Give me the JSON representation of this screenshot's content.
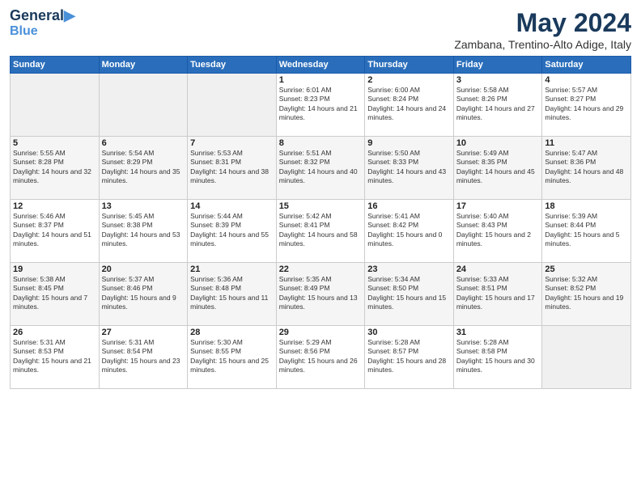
{
  "header": {
    "logo_line1": "General",
    "logo_line2": "Blue",
    "month": "May 2024",
    "location": "Zambana, Trentino-Alto Adige, Italy"
  },
  "weekdays": [
    "Sunday",
    "Monday",
    "Tuesday",
    "Wednesday",
    "Thursday",
    "Friday",
    "Saturday"
  ],
  "rows": [
    [
      {
        "day": "",
        "empty": true
      },
      {
        "day": "",
        "empty": true
      },
      {
        "day": "",
        "empty": true
      },
      {
        "day": "1",
        "sunrise": "6:01 AM",
        "sunset": "8:23 PM",
        "daylight": "14 hours and 21 minutes."
      },
      {
        "day": "2",
        "sunrise": "6:00 AM",
        "sunset": "8:24 PM",
        "daylight": "14 hours and 24 minutes."
      },
      {
        "day": "3",
        "sunrise": "5:58 AM",
        "sunset": "8:26 PM",
        "daylight": "14 hours and 27 minutes."
      },
      {
        "day": "4",
        "sunrise": "5:57 AM",
        "sunset": "8:27 PM",
        "daylight": "14 hours and 29 minutes."
      }
    ],
    [
      {
        "day": "5",
        "sunrise": "5:55 AM",
        "sunset": "8:28 PM",
        "daylight": "14 hours and 32 minutes."
      },
      {
        "day": "6",
        "sunrise": "5:54 AM",
        "sunset": "8:29 PM",
        "daylight": "14 hours and 35 minutes."
      },
      {
        "day": "7",
        "sunrise": "5:53 AM",
        "sunset": "8:31 PM",
        "daylight": "14 hours and 38 minutes."
      },
      {
        "day": "8",
        "sunrise": "5:51 AM",
        "sunset": "8:32 PM",
        "daylight": "14 hours and 40 minutes."
      },
      {
        "day": "9",
        "sunrise": "5:50 AM",
        "sunset": "8:33 PM",
        "daylight": "14 hours and 43 minutes."
      },
      {
        "day": "10",
        "sunrise": "5:49 AM",
        "sunset": "8:35 PM",
        "daylight": "14 hours and 45 minutes."
      },
      {
        "day": "11",
        "sunrise": "5:47 AM",
        "sunset": "8:36 PM",
        "daylight": "14 hours and 48 minutes."
      }
    ],
    [
      {
        "day": "12",
        "sunrise": "5:46 AM",
        "sunset": "8:37 PM",
        "daylight": "14 hours and 51 minutes."
      },
      {
        "day": "13",
        "sunrise": "5:45 AM",
        "sunset": "8:38 PM",
        "daylight": "14 hours and 53 minutes."
      },
      {
        "day": "14",
        "sunrise": "5:44 AM",
        "sunset": "8:39 PM",
        "daylight": "14 hours and 55 minutes."
      },
      {
        "day": "15",
        "sunrise": "5:42 AM",
        "sunset": "8:41 PM",
        "daylight": "14 hours and 58 minutes."
      },
      {
        "day": "16",
        "sunrise": "5:41 AM",
        "sunset": "8:42 PM",
        "daylight": "15 hours and 0 minutes."
      },
      {
        "day": "17",
        "sunrise": "5:40 AM",
        "sunset": "8:43 PM",
        "daylight": "15 hours and 2 minutes."
      },
      {
        "day": "18",
        "sunrise": "5:39 AM",
        "sunset": "8:44 PM",
        "daylight": "15 hours and 5 minutes."
      }
    ],
    [
      {
        "day": "19",
        "sunrise": "5:38 AM",
        "sunset": "8:45 PM",
        "daylight": "15 hours and 7 minutes."
      },
      {
        "day": "20",
        "sunrise": "5:37 AM",
        "sunset": "8:46 PM",
        "daylight": "15 hours and 9 minutes."
      },
      {
        "day": "21",
        "sunrise": "5:36 AM",
        "sunset": "8:48 PM",
        "daylight": "15 hours and 11 minutes."
      },
      {
        "day": "22",
        "sunrise": "5:35 AM",
        "sunset": "8:49 PM",
        "daylight": "15 hours and 13 minutes."
      },
      {
        "day": "23",
        "sunrise": "5:34 AM",
        "sunset": "8:50 PM",
        "daylight": "15 hours and 15 minutes."
      },
      {
        "day": "24",
        "sunrise": "5:33 AM",
        "sunset": "8:51 PM",
        "daylight": "15 hours and 17 minutes."
      },
      {
        "day": "25",
        "sunrise": "5:32 AM",
        "sunset": "8:52 PM",
        "daylight": "15 hours and 19 minutes."
      }
    ],
    [
      {
        "day": "26",
        "sunrise": "5:31 AM",
        "sunset": "8:53 PM",
        "daylight": "15 hours and 21 minutes."
      },
      {
        "day": "27",
        "sunrise": "5:31 AM",
        "sunset": "8:54 PM",
        "daylight": "15 hours and 23 minutes."
      },
      {
        "day": "28",
        "sunrise": "5:30 AM",
        "sunset": "8:55 PM",
        "daylight": "15 hours and 25 minutes."
      },
      {
        "day": "29",
        "sunrise": "5:29 AM",
        "sunset": "8:56 PM",
        "daylight": "15 hours and 26 minutes."
      },
      {
        "day": "30",
        "sunrise": "5:28 AM",
        "sunset": "8:57 PM",
        "daylight": "15 hours and 28 minutes."
      },
      {
        "day": "31",
        "sunrise": "5:28 AM",
        "sunset": "8:58 PM",
        "daylight": "15 hours and 30 minutes."
      },
      {
        "day": "",
        "empty": true
      }
    ]
  ]
}
